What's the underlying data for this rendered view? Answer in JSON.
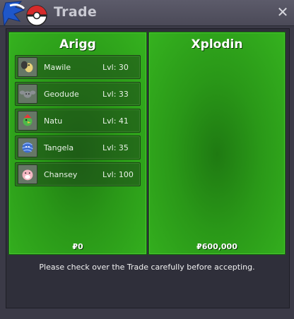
{
  "window": {
    "title": "Trade",
    "close_symbol": "✕"
  },
  "left_panel": {
    "trainer": "Arigg",
    "money": "₽0",
    "pokemon": [
      {
        "name": "Mawile",
        "level": "Lvl: 30",
        "icon": "mawile-icon"
      },
      {
        "name": "Geodude",
        "level": "Lvl: 33",
        "icon": "geodude-icon"
      },
      {
        "name": "Natu",
        "level": "Lvl: 41",
        "icon": "natu-icon"
      },
      {
        "name": "Tangela",
        "level": "Lvl: 35",
        "icon": "tangela-icon"
      },
      {
        "name": "Chansey",
        "level": "Lvl: 100",
        "icon": "chansey-icon"
      }
    ]
  },
  "right_panel": {
    "trainer": "Xplodin",
    "money": "₽600,000",
    "pokemon": []
  },
  "footer": {
    "message": "Please check over the Trade carefully before accepting."
  },
  "colors": {
    "panel_green": "#2a9818",
    "titlebar": "#4b4a58",
    "background": "#3b3a47"
  }
}
